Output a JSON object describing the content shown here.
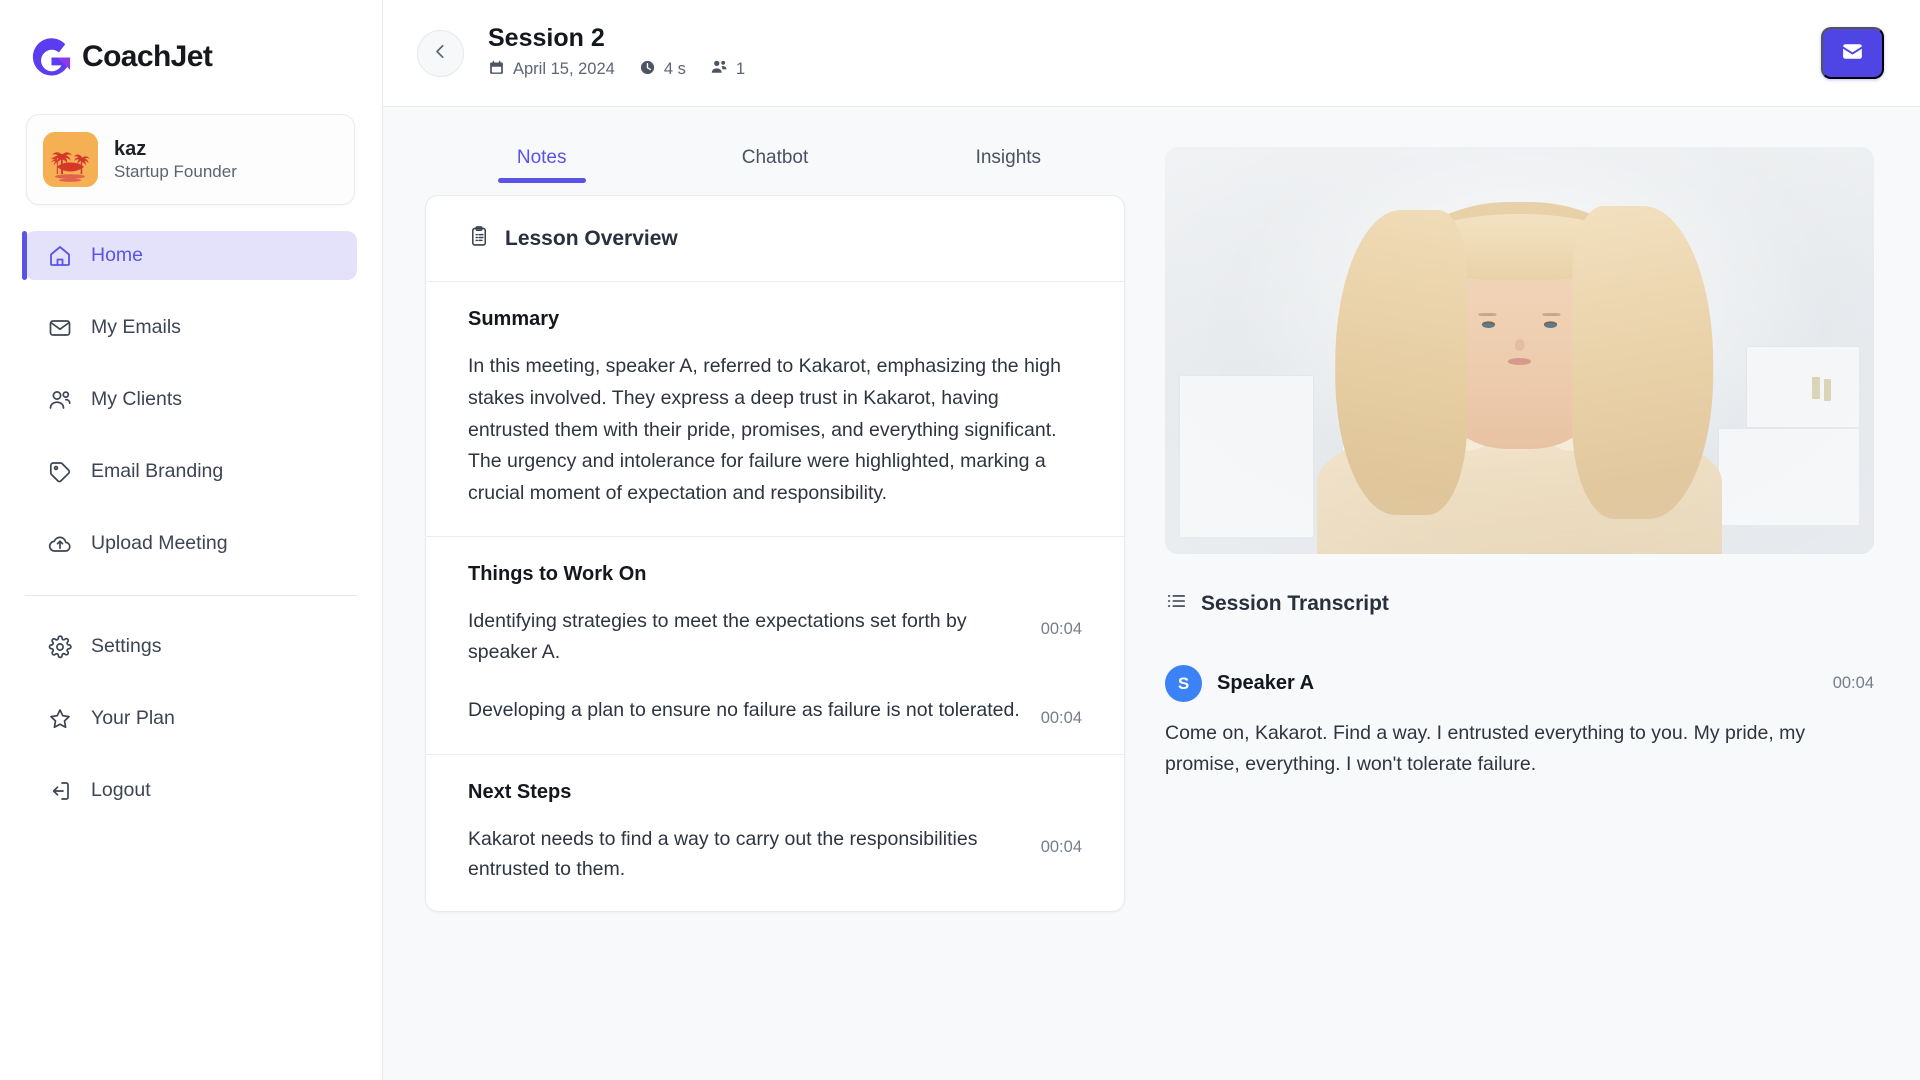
{
  "brand": {
    "name": "CoachJet",
    "logo_icon": "coachjet-g-logo",
    "accent": "#5b52e8"
  },
  "profile": {
    "name": "kaz",
    "role": "Startup Founder",
    "avatar_icon": "palm-island-avatar",
    "avatar_bg": "#f5b053"
  },
  "sidebar": {
    "items": [
      {
        "label": "Home",
        "icon": "home-icon",
        "active": true
      },
      {
        "label": "My Emails",
        "icon": "envelope-icon",
        "active": false
      },
      {
        "label": "My Clients",
        "icon": "users-icon",
        "active": false
      },
      {
        "label": "Email Branding",
        "icon": "tag-icon",
        "active": false
      },
      {
        "label": "Upload Meeting",
        "icon": "cloud-upload-icon",
        "active": false
      }
    ],
    "footer_items": [
      {
        "label": "Settings",
        "icon": "gear-icon"
      },
      {
        "label": "Your Plan",
        "icon": "star-icon"
      },
      {
        "label": "Logout",
        "icon": "logout-icon"
      }
    ]
  },
  "topbar": {
    "back_icon": "chevron-left-icon",
    "title": "Session 2",
    "date": "April 15, 2024",
    "date_icon": "calendar-icon",
    "duration": "4 s",
    "duration_icon": "clock-icon",
    "participants": "1",
    "participants_icon": "users-icon",
    "mail_button_icon": "envelope-icon",
    "mail_button_color": "#4f45e4"
  },
  "tabs": [
    {
      "label": "Notes",
      "active": true
    },
    {
      "label": "Chatbot",
      "active": false
    },
    {
      "label": "Insights",
      "active": false
    }
  ],
  "lesson_overview": {
    "icon": "clipboard-list-icon",
    "title": "Lesson Overview",
    "summary": {
      "title": "Summary",
      "text": "In this meeting, speaker A, referred to Kakarot, emphasizing the high stakes involved. They express a deep trust in Kakarot, having entrusted them with their pride, promises, and everything significant. The urgency and intolerance for failure were highlighted, marking a crucial moment of expectation and responsibility."
    },
    "things_to_work_on": {
      "title": "Things to Work On",
      "items": [
        {
          "text": "Identifying strategies to meet the expectations set forth by speaker A.",
          "time": "00:04"
        },
        {
          "text": "Developing a plan to ensure no failure as failure is not tolerated.",
          "time": "00:04"
        }
      ]
    },
    "next_steps": {
      "title": "Next Steps",
      "items": [
        {
          "text": "Kakarot needs to find a way to carry out the responsibilities entrusted to them.",
          "time": "00:04"
        }
      ]
    }
  },
  "video": {
    "alt": "Session video thumbnail of a blonde woman in a bright white office"
  },
  "transcript": {
    "icon": "list-icon",
    "title": "Session Transcript",
    "entries": [
      {
        "initial": "S",
        "speaker": "Speaker A",
        "time": "00:04",
        "text": "Come on, Kakarot. Find a way. I entrusted everything to you. My pride, my promise, everything. I won't tolerate failure."
      }
    ]
  }
}
